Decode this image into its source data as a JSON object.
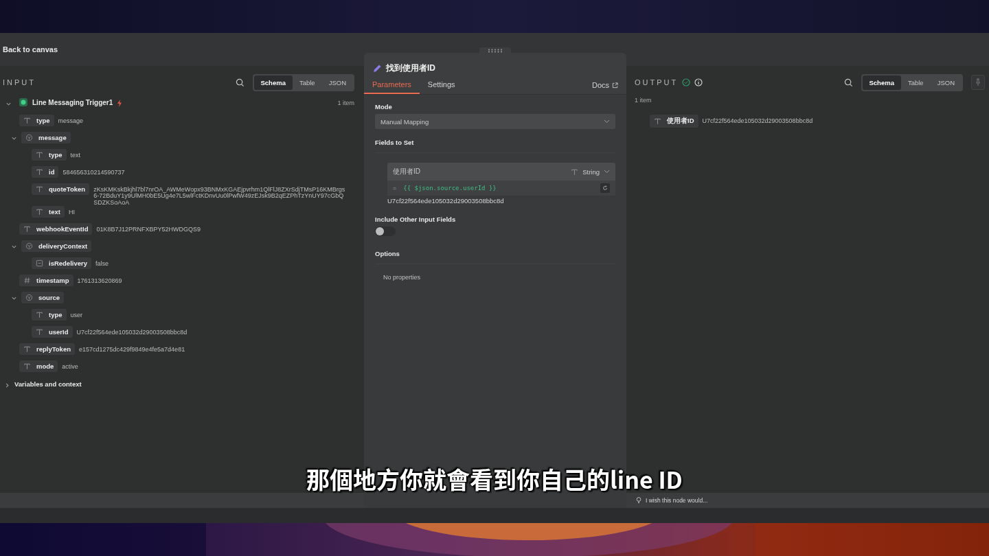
{
  "header": {
    "back_link": "Back to canvas"
  },
  "input_panel": {
    "title": "INPUT",
    "view_tabs": [
      {
        "label": "Schema",
        "selected": true
      },
      {
        "label": "Table",
        "selected": false
      },
      {
        "label": "JSON",
        "selected": false
      }
    ],
    "tree": {
      "label": "Line Messaging Trigger1",
      "count": "1 item",
      "expanded": true,
      "children": [
        {
          "kind": "string",
          "key": "type",
          "value": "message"
        },
        {
          "kind": "object",
          "key": "message",
          "expanded": true,
          "children": [
            {
              "kind": "string",
              "key": "type",
              "value": "text"
            },
            {
              "kind": "string",
              "key": "id",
              "value": "584656310214590737"
            },
            {
              "kind": "string",
              "key": "quoteToken",
              "value": "zKsKMKskBkjhl7bl7nrOA_AWMeWopx93BNMxKGAEjpvrhm1QlFlJ8ZXrSdjTMsP16KMBrgs6-72BduY1y9UlMH0bE5Ug4e7L5wlFctKDnvUu0lPwfW49zEJsk9B2qEZPhTzYnUY97cGbQSDZKSoAoA"
            },
            {
              "kind": "string",
              "key": "text",
              "value": "HI"
            }
          ]
        },
        {
          "kind": "string",
          "key": "webhookEventId",
          "value": "01K8B7J12PRNFXBPY52HWDGQS9"
        },
        {
          "kind": "object",
          "key": "deliveryContext",
          "expanded": true,
          "children": [
            {
              "kind": "boolean",
              "key": "isRedelivery",
              "value": "false"
            }
          ]
        },
        {
          "kind": "number",
          "key": "timestamp",
          "value": "1761313620869"
        },
        {
          "kind": "object",
          "key": "source",
          "expanded": true,
          "children": [
            {
              "kind": "string",
              "key": "type",
              "value": "user"
            },
            {
              "kind": "string",
              "key": "userId",
              "value": "U7cf22f564ede105032d29003508bbc8d"
            }
          ]
        },
        {
          "kind": "string",
          "key": "replyToken",
          "value": "e157cd1275dc429f9849e4fe5a7d4e81"
        },
        {
          "kind": "string",
          "key": "mode",
          "value": "active"
        }
      ]
    },
    "variables": {
      "label": "Variables and context",
      "expanded": false
    }
  },
  "node_panel": {
    "title": "找到使用者ID",
    "tabs": [
      {
        "label": "Parameters",
        "selected": true
      },
      {
        "label": "Settings",
        "selected": false
      }
    ],
    "docs": "Docs",
    "mode_label": "Mode",
    "mode_value": "Manual Mapping",
    "fields_label": "Fields to Set",
    "field": {
      "name": "使用者ID",
      "type": "String",
      "prefix": "=",
      "expression": "{{ $json.source.userId }}",
      "result": "U7cf22f564ede105032d29003508bbc8d"
    },
    "include_label": "Include Other Input Fields",
    "include_on": false,
    "options_label": "Options",
    "options_empty": "No properties"
  },
  "output_panel": {
    "title": "OUTPUT",
    "view_tabs": [
      {
        "label": "Schema",
        "selected": true
      },
      {
        "label": "Table",
        "selected": false
      },
      {
        "label": "JSON",
        "selected": false
      }
    ],
    "count": "1 item",
    "rows": [
      {
        "kind": "string",
        "key": "使用者ID",
        "value": "U7cf22f564ede105032d29003508bbc8d"
      }
    ]
  },
  "feedback": "I wish this node would...",
  "subtitle": "那個地方你就會看到你自己的line ID"
}
